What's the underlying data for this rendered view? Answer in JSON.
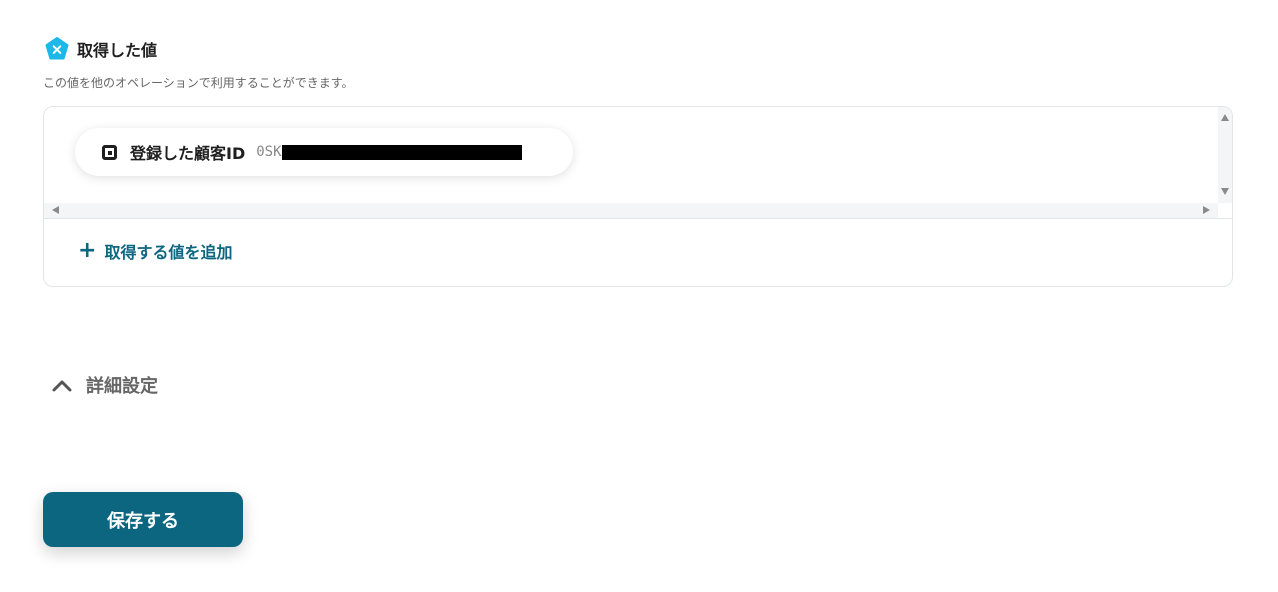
{
  "section": {
    "title": "取得した値",
    "description": "この値を他のオペレーションで利用することができます。",
    "badge_icon": "x-badge-icon",
    "badge_color": "#1bb8e8"
  },
  "values": [
    {
      "label": "登録した顧客ID",
      "value_prefix": "0SK",
      "icon": "square-dot-icon"
    }
  ],
  "add_value_label": "取得する値を追加",
  "details_label": "詳細設定",
  "save_label": "保存する",
  "colors": {
    "accent": "#0d6680"
  }
}
